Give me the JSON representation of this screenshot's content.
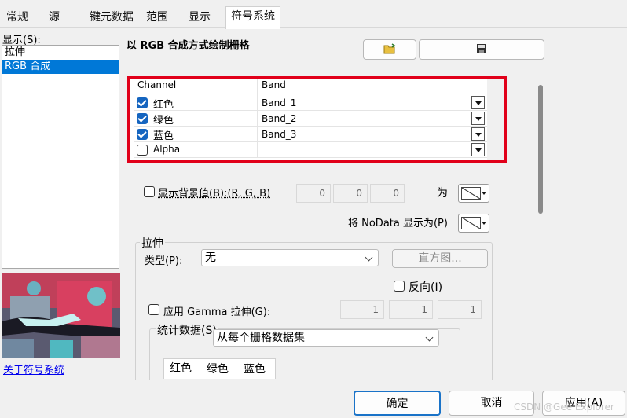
{
  "tabs": [
    "常规",
    "源",
    "键元数据",
    "范围",
    "显示",
    "符号系统"
  ],
  "left": {
    "show_label": "显示(S):",
    "items": [
      "拉伸",
      "RGB 合成"
    ],
    "about_link": "关于符号系统"
  },
  "main": {
    "title": "以 RGB 合成方式绘制栅格",
    "grid": {
      "col_channel": "Channel",
      "col_band": "Band",
      "rows": [
        {
          "channel": "红色",
          "band": "Band_1",
          "checked": true
        },
        {
          "channel": "绿色",
          "band": "Band_2",
          "checked": true
        },
        {
          "channel": "蓝色",
          "band": "Band_3",
          "checked": true
        },
        {
          "channel": "Alpha",
          "band": "",
          "checked": false
        }
      ]
    },
    "background": {
      "label": "显示背景值(B):(R, G, B)",
      "r": "0",
      "g": "0",
      "b": "0",
      "as_label": "为"
    },
    "nodata_label": "将 NoData 显示为(P)",
    "stretch": {
      "group_label": "拉伸",
      "type_label": "类型(P):",
      "type_value": "无",
      "histogram_button": "直方图...",
      "invert_label": "反向(I)",
      "gamma_label": "应用 Gamma 拉伸(G):",
      "gamma_values": [
        "1",
        "1",
        "1"
      ],
      "stats_label": "统计数据(S)",
      "stats_value": "从每个栅格数据集",
      "stats_tabs": [
        "红色",
        "绿色",
        "蓝色"
      ]
    }
  },
  "footer": {
    "ok": "确定",
    "cancel": "取消",
    "apply": "应用(A)",
    "watermark": "CSDN @Gee Explorer"
  },
  "colors": {
    "highlight": "#0078d7",
    "checkbox": "#1565c0",
    "annotation_box": "#e1001a"
  }
}
